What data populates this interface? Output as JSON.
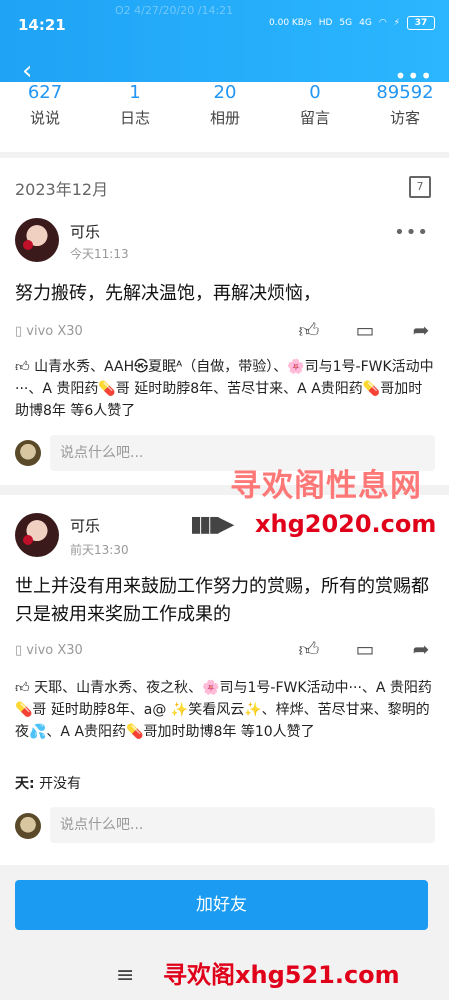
{
  "statusbar": {
    "time": "14:21",
    "ghost_text": "O2 4/27/20/20 /14:21",
    "net_speed": "0.00 KB/s",
    "hd": "HD",
    "sig1": "5G",
    "sig2": "4G",
    "battery": "37"
  },
  "header": {
    "back_icon": "chevron-left-icon",
    "more_icon": "more-horizontal-icon"
  },
  "stats": [
    {
      "num": "627",
      "label": "说说"
    },
    {
      "num": "1",
      "label": "日志"
    },
    {
      "num": "20",
      "label": "相册"
    },
    {
      "num": "0",
      "label": "留言"
    },
    {
      "num": "89592",
      "label": "访客"
    }
  ],
  "date_header": "2023年12月",
  "calendar_day": "7",
  "posts": [
    {
      "user": "可乐",
      "time": "今天11:13",
      "content": "努力搬砖，先解决温饱，再解决烦恼，",
      "device": "vivo X30",
      "likes": "山青水秀、AAH㉿夏眠ᴬ（自做，带验）、🌸司与1号-FWK活动中···、A 贵阳药💊哥 延时助脖8年、苦尽甘来、A A贵阳药💊哥加时助博8年 等6人赞了",
      "comment_placeholder": "说点什么吧..."
    },
    {
      "user": "可乐",
      "time": "前天13:30",
      "content": "世上并没有用来鼓励工作努力的赏赐，所有的赏赐都只是被用来奖励工作成果的",
      "device": "vivo X30",
      "likes": "天耶、山青水秀、夜之秋、🌸司与1号-FWK活动中···、A 贵阳药💊哥 延时助脖8年、a@ ✨笑看风云✨、梓烨、苦尽甘来、黎明的夜💦、A A贵阳药💊哥加时助博8年 等10人赞了",
      "comment_user": "天:",
      "comment_text": "开没有",
      "comment_placeholder": "说点什么吧..."
    }
  ],
  "add_friend": "加好友",
  "menu_icon": "≡",
  "watermarks": {
    "w1": "寻欢阁性息网",
    "w2": "xhg2020.com",
    "w3": "寻欢阁xhg521.com",
    "arrow": "▮▮▮▶"
  }
}
